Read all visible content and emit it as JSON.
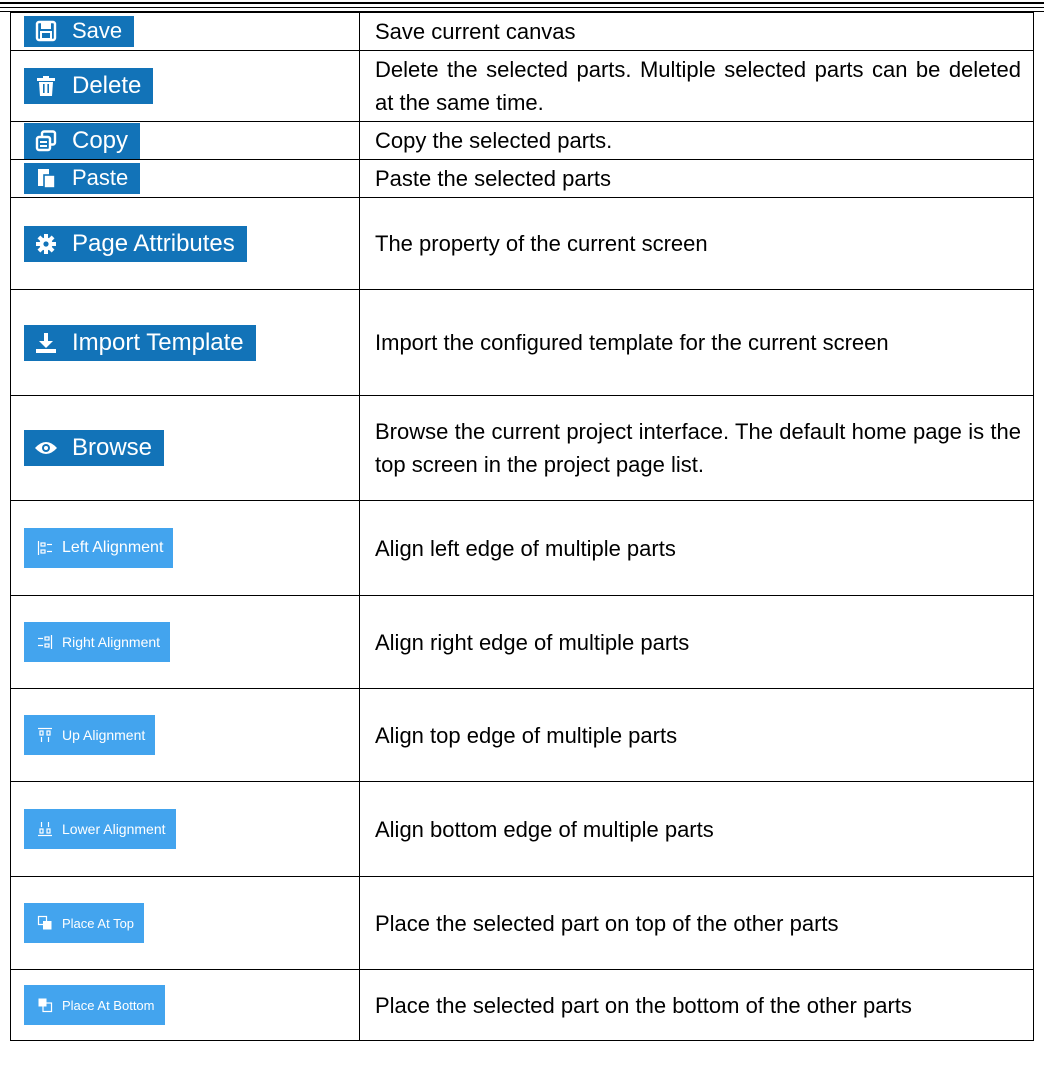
{
  "rows": [
    {
      "button": "Save",
      "icon": "save-icon",
      "description": "Save current canvas"
    },
    {
      "button": "Delete",
      "icon": "trash-icon",
      "description": "Delete the selected parts. Multiple selected parts can be deleted at the same time."
    },
    {
      "button": "Copy",
      "icon": "copy-icon",
      "description": "Copy the selected parts."
    },
    {
      "button": "Paste",
      "icon": "paste-icon",
      "description": "Paste the selected parts"
    },
    {
      "button": "Page Attributes",
      "icon": "gear-icon",
      "description": "The property of the current screen"
    },
    {
      "button": "Import Template",
      "icon": "download-icon",
      "description": "Import the configured template for the current screen"
    },
    {
      "button": "Browse",
      "icon": "eye-icon",
      "description": "Browse the current project interface. The default home page is the top screen in the project page list."
    },
    {
      "button": "Left Alignment",
      "icon": "align-left-icon",
      "description": "Align left edge of multiple parts"
    },
    {
      "button": "Right Alignment",
      "icon": "align-right-icon",
      "description": "Align right edge of multiple parts"
    },
    {
      "button": "Up Alignment",
      "icon": "align-top-icon",
      "description": "Align top edge of multiple parts"
    },
    {
      "button": "Lower Alignment",
      "icon": "align-bottom-icon",
      "description": "Align bottom edge of multiple parts"
    },
    {
      "button": "Place At Top",
      "icon": "bring-to-front-icon",
      "description": "Place the selected part on top of the other parts"
    },
    {
      "button": "Place At Bottom",
      "icon": "send-to-back-icon",
      "description": "Place the selected part on the bottom of the other parts"
    }
  ],
  "colors": {
    "dark_button": "#1273b8",
    "light_button": "#43a4ee",
    "button_text": "#ffffff"
  }
}
